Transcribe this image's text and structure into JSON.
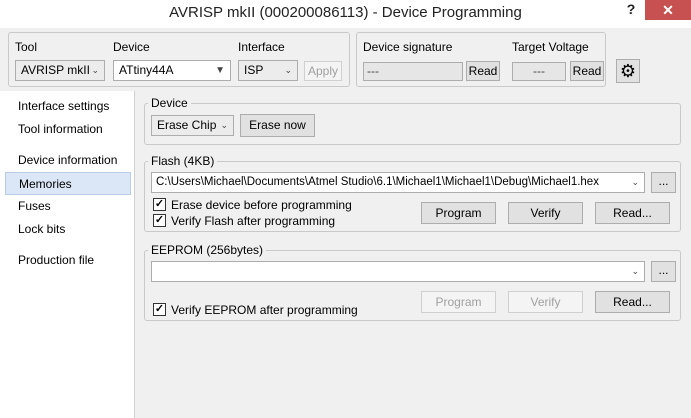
{
  "window": {
    "title": "AVRISP mkII (000200086113) - Device Programming",
    "help_glyph": "?",
    "close_glyph": "✕"
  },
  "toolbar": {
    "tool_label": "Tool",
    "tool_value": "AVRISP mkII",
    "device_label": "Device",
    "device_value": "ATtiny44A",
    "interface_label": "Interface",
    "interface_value": "ISP",
    "apply_label": "Apply",
    "signature_label": "Device signature",
    "signature_value": "---",
    "voltage_label": "Target Voltage",
    "voltage_value": "---",
    "read_label": "Read",
    "settings_icon": "gear-icon"
  },
  "sidebar": {
    "items": [
      {
        "label": "Interface settings"
      },
      {
        "label": "Tool information"
      },
      {
        "label": "Device information"
      },
      {
        "label": "Memories",
        "selected": true
      },
      {
        "label": "Fuses"
      },
      {
        "label": "Lock bits"
      },
      {
        "label": "Production file"
      }
    ]
  },
  "device_section": {
    "title": "Device",
    "erase_mode": "Erase Chip",
    "erase_now": "Erase now"
  },
  "flash_section": {
    "title": "Flash (4KB)",
    "file_path": "C:\\Users\\Michael\\Documents\\Atmel Studio\\6.1\\Michael1\\Michael1\\Debug\\Michael1.hex",
    "browse": "...",
    "erase_before": "Erase device before programming",
    "verify_after": "Verify Flash after programming",
    "program": "Program",
    "verify": "Verify",
    "read": "Read..."
  },
  "eeprom_section": {
    "title": "EEPROM (256bytes)",
    "file_path": "",
    "browse": "...",
    "verify_after": "Verify EEPROM after programming",
    "program": "Program",
    "verify": "Verify",
    "read": "Read..."
  },
  "colors": {
    "close_button": "#c75050",
    "selected_nav": "#dbe7f7"
  }
}
